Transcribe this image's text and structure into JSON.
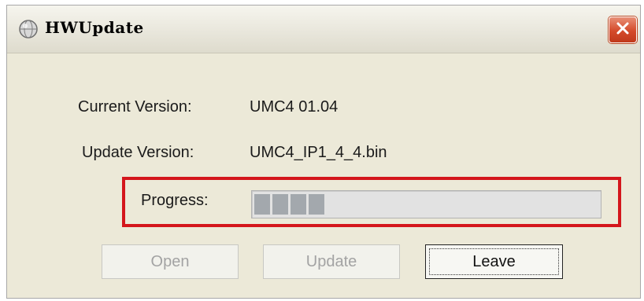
{
  "window": {
    "title": "HWUpdate",
    "icon": "globe-icon",
    "close_icon": "close-icon"
  },
  "info": {
    "current_version_label": "Current Version:",
    "current_version_value": "UMC4 01.04",
    "update_version_label": "Update Version:",
    "update_version_value": "UMC4_IP1_4_4.bin",
    "progress_label": "Progress:",
    "progress_value": 0.22,
    "progress_blocks": 4
  },
  "buttons": {
    "open_label": "Open",
    "update_label": "Update",
    "leave_label": "Leave"
  },
  "colors": {
    "highlight": "#d4161c",
    "close_button": "#d44a2a",
    "window_bg": "#ece9d8"
  }
}
